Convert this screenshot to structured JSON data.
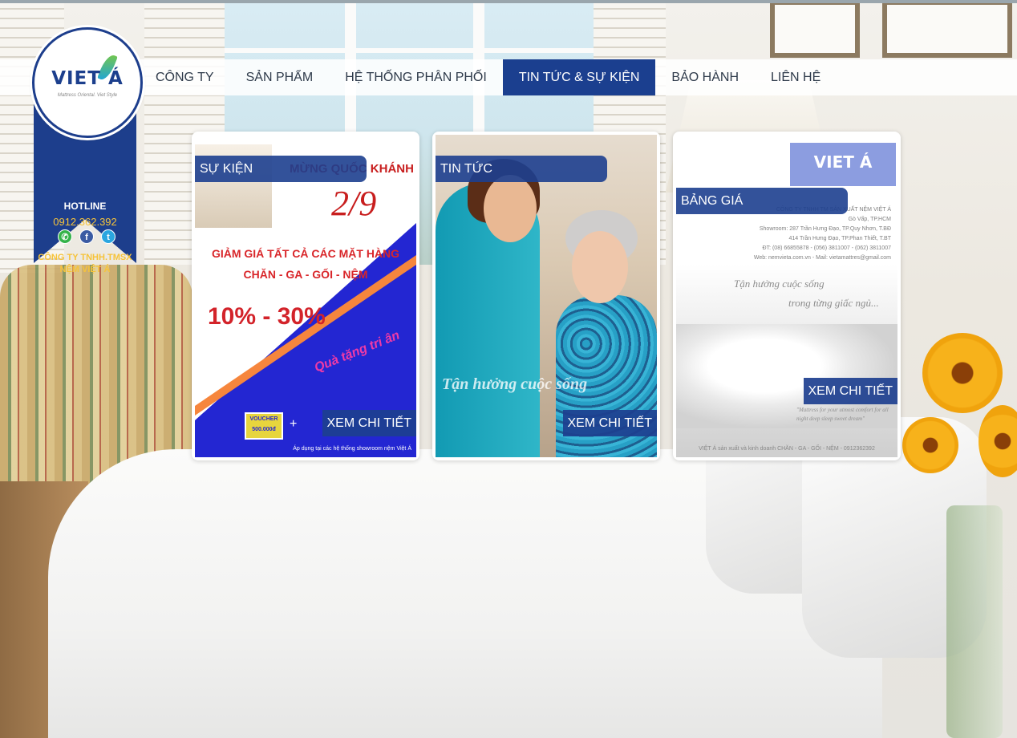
{
  "nav": {
    "items": [
      {
        "label": "CÔNG TY"
      },
      {
        "label": "SẢN PHẨM"
      },
      {
        "label": "HỆ THỐNG PHÂN PHỐI"
      },
      {
        "label": "TIN TỨC & SỰ KIỆN",
        "active": true
      },
      {
        "label": "BẢO HÀNH"
      },
      {
        "label": "LIÊN HỆ"
      }
    ]
  },
  "brand": {
    "logo_text": "VIET Á",
    "tagline": "Mattress Oriental. Viet Style",
    "hotline_label": "HOTLINE",
    "hotline_number": "0912.362.392",
    "company_line1": "CÔNG TY TNHH.TMSX",
    "company_line2": "NỆM VIỆT Á",
    "social": [
      "phone-icon",
      "facebook-icon",
      "twitter-icon"
    ],
    "colors": {
      "primary": "#1d3e8c",
      "accent": "#f6c33a"
    }
  },
  "cards": [
    {
      "tag": "SỰ KIỆN",
      "button": "XEM CHI TIẾT",
      "art": {
        "title": "MỪNG QUỐC KHÁNH",
        "date": "2/9",
        "line1": "GIẢM GIÁ TẤT CẢ CÁC MẶT HÀNG",
        "line2": "CHĂN - GA - GỐI - NỆM",
        "percent": "10% - 30%",
        "gift": "Quà tặng tri ân",
        "voucher": "VOUCHER 500.000đ",
        "plus": "+",
        "apply": "Áp dụng tại các hệ thống showroom nệm Việt Á"
      }
    },
    {
      "tag": "TIN TỨC",
      "button": "XEM CHI TIẾT",
      "art": {
        "slogan": "Tận hưởng cuộc sống"
      }
    },
    {
      "tag": "BẢNG GIÁ",
      "button": "XEM CHI TIẾT",
      "art": {
        "logo": "VIET Á",
        "info_lines": [
          "CÔNG TY TNHH TM SẢN XUẤT NỆM VIỆT Á",
          "Gò Vấp, TP.HCM",
          "Showroom: 287 Trần Hưng Đạo, TP.Quy Nhơn, T.BĐ",
          "414 Trần Hưng Đạo, TP.Phan Thiết, T.BT",
          "ĐT: (08) 66855878 - (056) 3811007 - (062) 3811007",
          "Web: nemvieta.com.vn - Mail: vietamattres@gmail.com"
        ],
        "script1": "Tận hưởng cuộc sống",
        "script2": "trong từng giấc ngủ...",
        "quote": "\"Mattress for your utmost comfort for all night deep sleep sweet dream\"",
        "footer": "VIỆT Á sản xuất và kinh doanh CHĂN - GA - GỐI - NỆM - 0912362392"
      }
    }
  ]
}
